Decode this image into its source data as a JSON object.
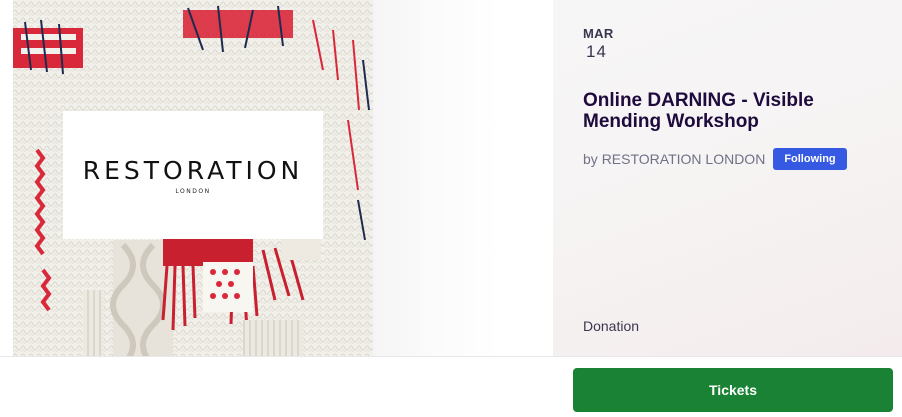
{
  "event": {
    "image_alt": "Restoration London knit sweater with visible mending",
    "logo": {
      "wordmark": "RESTORATION",
      "subtitle": "LONDON"
    },
    "date": {
      "month": "MAR",
      "day": "14"
    },
    "title": "Online DARNING - Visible Mending Workshop",
    "organizer": {
      "prefix": "by",
      "name": "RESTORATION LONDON",
      "follow_label": "Following"
    },
    "price": "Donation"
  },
  "actions": {
    "tickets_label": "Tickets"
  },
  "colors": {
    "brand_green": "#198234",
    "following_blue": "#3659e3",
    "title_text": "#1e0a3c"
  }
}
